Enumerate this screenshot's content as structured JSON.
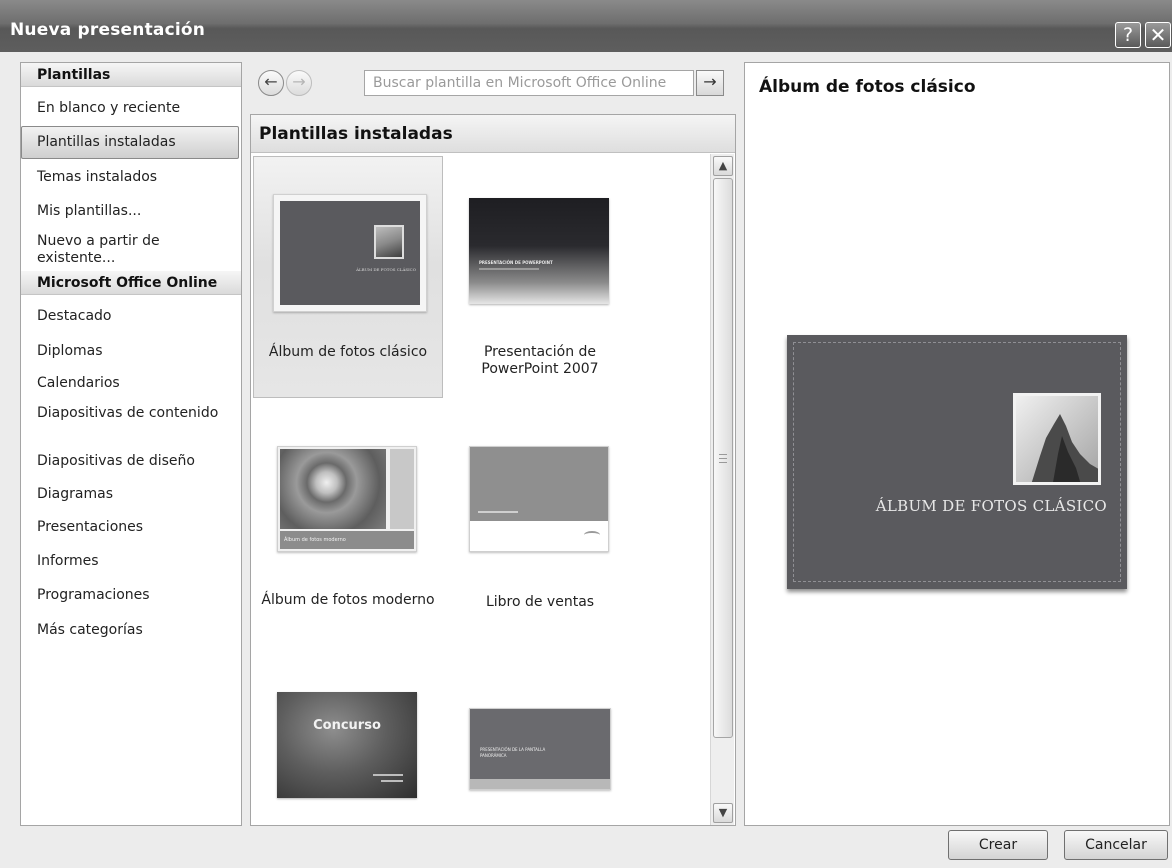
{
  "window": {
    "title": "Nueva presentación",
    "help_glyph": "?",
    "close_glyph": "✕"
  },
  "left_nav": {
    "sections": [
      {
        "header": "Plantillas",
        "items": [
          "En blanco y reciente",
          "Plantillas instaladas",
          "Temas instalados",
          "Mis plantillas...",
          "Nuevo a partir de existente..."
        ]
      },
      {
        "header": "Microsoft Office Online",
        "items": [
          "Destacado",
          "Diplomas",
          "Calendarios",
          "Diapositivas de contenido",
          "Diapositivas de diseño",
          "Diagramas",
          "Presentaciones",
          "Informes",
          "Programaciones",
          "Más categorías"
        ]
      }
    ],
    "selected": "Plantillas instaladas"
  },
  "toolbar": {
    "back_glyph": "←",
    "forward_glyph": "→",
    "search_placeholder": "Buscar plantilla en Microsoft Office Online",
    "go_glyph": "→"
  },
  "middle": {
    "header": "Plantillas instaladas",
    "templates": [
      {
        "label": "Álbum de fotos clásico",
        "thumb_text": "ÁLBUM DE FOTOS CLÁSICO",
        "selected": true
      },
      {
        "label": "Presentación de PowerPoint 2007",
        "thumb_text": "PRESENTACIÓN DE POWERPOINT"
      },
      {
        "label": "Álbum de fotos moderno",
        "thumb_text": "Álbum de fotos moderno"
      },
      {
        "label": "Libro de ventas",
        "thumb_text": ""
      },
      {
        "label": "",
        "thumb_text": "Concurso"
      },
      {
        "label": "",
        "thumb_text": "PRESENTACIÓN DE LA PANTALLA PANORÁMICA"
      }
    ]
  },
  "preview": {
    "title": "Álbum de fotos clásico",
    "slide_text": "ÁLBUM DE FOTOS CLÁSICO"
  },
  "buttons": {
    "create": "Crear",
    "cancel": "Cancelar"
  },
  "colors": {
    "title_bar": "#666666",
    "slide_bg": "#5a5a5e",
    "panel_border": "#a5a5a5"
  }
}
